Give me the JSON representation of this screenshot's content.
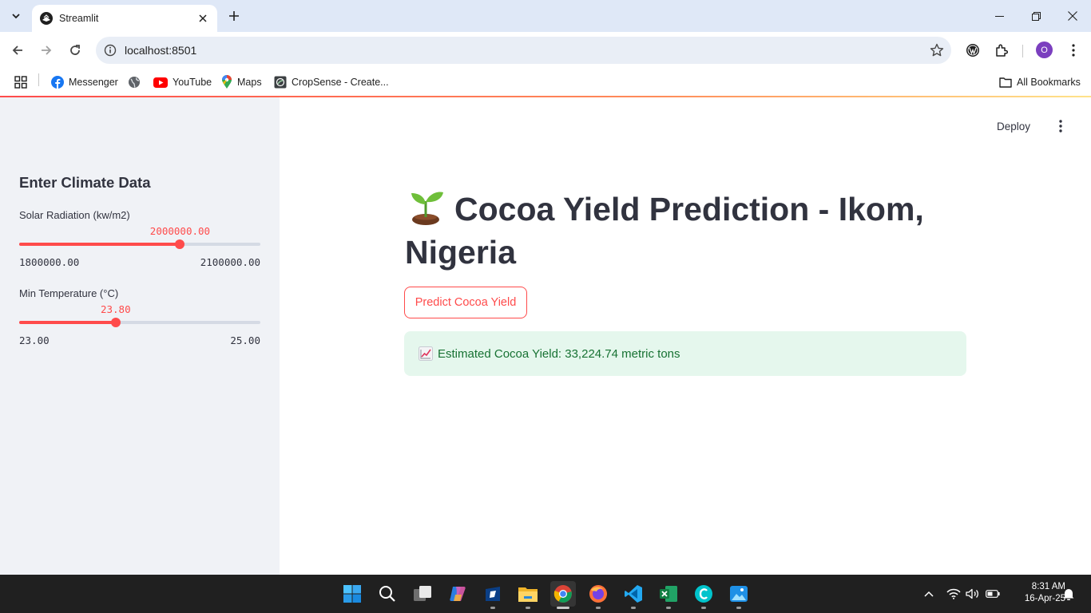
{
  "browser": {
    "tab_title": "Streamlit",
    "url": "localhost:8501",
    "avatar_letter": "O",
    "bookmarks": [
      "Messenger",
      "YouTube",
      "Maps",
      "CropSense - Create..."
    ],
    "all_bookmarks": "All Bookmarks"
  },
  "app": {
    "deploy_label": "Deploy",
    "title": "Cocoa Yield Prediction - Ikom, Nigeria",
    "predict_button": "Predict Cocoa Yield",
    "result_text": "Estimated Cocoa Yield: 33,224.74 metric tons",
    "accent_color": "#ff4b4b",
    "success_bg": "#e5f7ed",
    "success_text_color": "#177233"
  },
  "sidebar": {
    "header": "Enter Climate Data",
    "sliders": [
      {
        "label": "Solar Radiation (kw/m2)",
        "value": "2000000.00",
        "min": "1800000.00",
        "max": "2100000.00",
        "fraction": 0.667
      },
      {
        "label": "Min Temperature (°C)",
        "value": "23.80",
        "min": "23.00",
        "max": "25.00",
        "fraction": 0.4
      }
    ]
  },
  "taskbar": {
    "time": "8:31 AM",
    "date": "16-Apr-25",
    "apps": [
      "start-icon",
      "search-icon",
      "task-view-icon",
      "copilot-icon",
      "store-icon",
      "file-explorer-icon",
      "chrome-icon",
      "firefox-icon",
      "vscode-icon",
      "excel-icon",
      "canva-icon",
      "photos-icon"
    ]
  }
}
